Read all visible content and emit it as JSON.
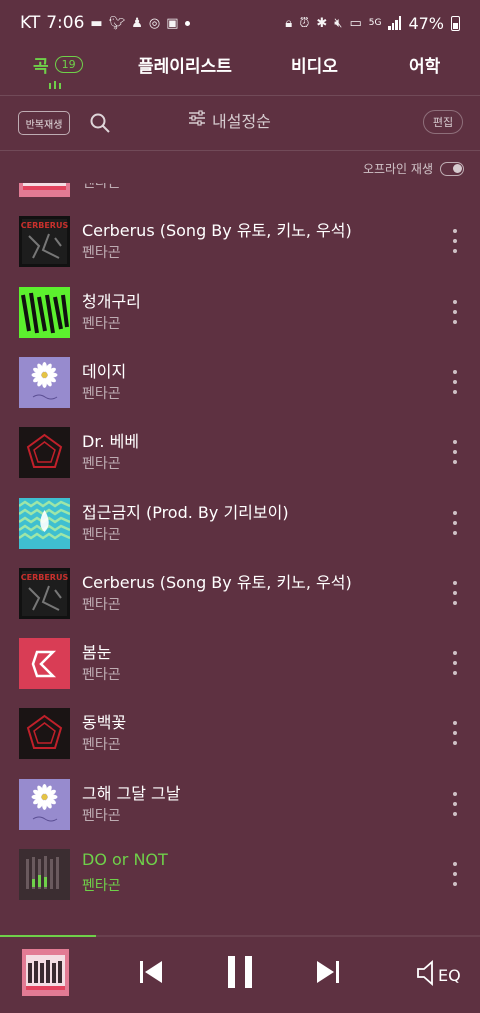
{
  "status_bar": {
    "carrier": "KT",
    "time": "7:06",
    "network": "5G",
    "battery": "47%"
  },
  "tabs": [
    {
      "label": "곡",
      "badge": "19",
      "active": true
    },
    {
      "label": "플레이리스트",
      "active": false
    },
    {
      "label": "비디오",
      "active": false
    },
    {
      "label": "어학",
      "active": false
    }
  ],
  "toolbar": {
    "repeat_label": "반복재생",
    "sort_label": "내설정순",
    "edit_label": "편집"
  },
  "offline": {
    "label": "오프라인 재생",
    "enabled": false
  },
  "songs": [
    {
      "title": "",
      "artist": "펜타곤",
      "art": "pink-collage",
      "active": false
    },
    {
      "title": "Cerberus (Song By 유토, 키노, 우석)",
      "artist": "펜타곤",
      "art": "dark-cerberus",
      "active": false
    },
    {
      "title": "청개구리",
      "artist": "펜타곤",
      "art": "green-wow",
      "active": false
    },
    {
      "title": "데이지",
      "artist": "펜타곤",
      "art": "purple-daisy",
      "active": false
    },
    {
      "title": "Dr. 베베",
      "artist": "펜타곤",
      "art": "black-red-logo",
      "active": false
    },
    {
      "title": "접근금지 (Prod. By 기리보이)",
      "artist": "펜타곤",
      "art": "teal-wave",
      "active": false
    },
    {
      "title": "Cerberus (Song By 유토, 키노, 우석)",
      "artist": "펜타곤",
      "art": "dark-cerberus",
      "active": false
    },
    {
      "title": "봄눈",
      "artist": "펜타곤",
      "art": "red-pentagon",
      "active": false
    },
    {
      "title": "동백꽃",
      "artist": "펜타곤",
      "art": "black-red-logo",
      "active": false
    },
    {
      "title": "그해 그달 그날",
      "artist": "펜타곤",
      "art": "purple-daisy",
      "active": false
    },
    {
      "title": "DO or NOT",
      "artist": "펜타곤",
      "art": "dark-bars",
      "active": true
    }
  ],
  "player": {
    "progress": 0.2,
    "eq_label": "EQ",
    "accent": "#6fd04a"
  },
  "colors": {
    "background": "#5e3141",
    "accent": "#6fd04a"
  }
}
